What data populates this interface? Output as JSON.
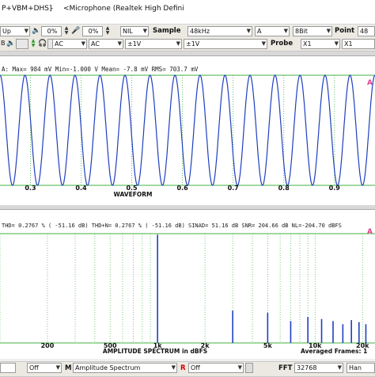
{
  "window": {
    "title_left": "P+VBM+DHS]",
    "title_sep": "-",
    "title_right": "<Microphone (Realtek High Defini"
  },
  "toolbar1": {
    "mode": "Up",
    "pct1": "0%",
    "pct2": "0%",
    "nil": "NIL",
    "sample_label": "Sample",
    "sample_value": "48kHz",
    "channel": "A",
    "bits": "8Bit",
    "point_label": "Point",
    "point_value": "48"
  },
  "toolbar2": {
    "coupling1": "AC",
    "coupling2": "AC",
    "range1": "±1V",
    "range2": "±1V",
    "probe_label": "Probe",
    "probe1": "X1",
    "probe2": "X1"
  },
  "waveform": {
    "stats": "A: Max=   984 mV   Min=-1.000  V   Mean=   -7.8 mV   RMS=  703.7 mV",
    "xlabel": "WAVEFORM",
    "ticks": [
      "0.3",
      "0.4",
      "0.5",
      "0.6",
      "0.7",
      "0.8",
      "0.9"
    ],
    "marker": "A",
    "color": "#1f3fbf"
  },
  "spectrum": {
    "stats": "THD=  0.2767 % ( -51.16 dB)   THD+N=  0.2767 % ( -51.16 dB)    SINAD=   51.16 dB   SNR= 204.66 dB   NL=-204.70 dBFS",
    "xlabel": "AMPLITUDE SPECTRUM  in dBFS",
    "ticks": [
      "200",
      "500",
      "1k",
      "2k",
      "5k",
      "10k",
      "20k"
    ],
    "frames": "Averaged Frames: 1",
    "marker": "A",
    "color": "#1f3fbf"
  },
  "bottombar": {
    "off1": "Off",
    "m_label": "M",
    "view": "Amplitude Spectrum",
    "r_label": "R",
    "off2": "Off",
    "fft_label": "FFT",
    "fft_size": "32768",
    "window_fn": "Han"
  },
  "chart_data": [
    {
      "type": "line",
      "xlabel": "WAVEFORM",
      "xlim": [
        0.24,
        0.98
      ],
      "ylim": [
        -1.0,
        0.984
      ],
      "x_ticks": [
        0.3,
        0.4,
        0.5,
        0.6,
        0.7,
        0.8,
        0.9
      ],
      "series": [
        {
          "cycles_visible": 15,
          "amplitude_max_mV": 984,
          "amplitude_min_V": -1.0
        }
      ]
    },
    {
      "type": "bar",
      "xlabel": "AMPLITUDE SPECTRUM  in dBFS",
      "x_scale": "log",
      "xlim": [
        100,
        24000
      ],
      "ylim": [
        -210,
        0
      ],
      "x_ticks": [
        200,
        500,
        1000,
        2000,
        5000,
        10000,
        20000
      ],
      "x": [
        1000,
        3000,
        5000,
        7000,
        9000,
        11000,
        13000,
        15000,
        17000,
        19000,
        21000
      ],
      "values": [
        -2,
        -148,
        -152,
        -168,
        -160,
        -164,
        -168,
        -174,
        -166,
        -170,
        -174
      ]
    }
  ]
}
